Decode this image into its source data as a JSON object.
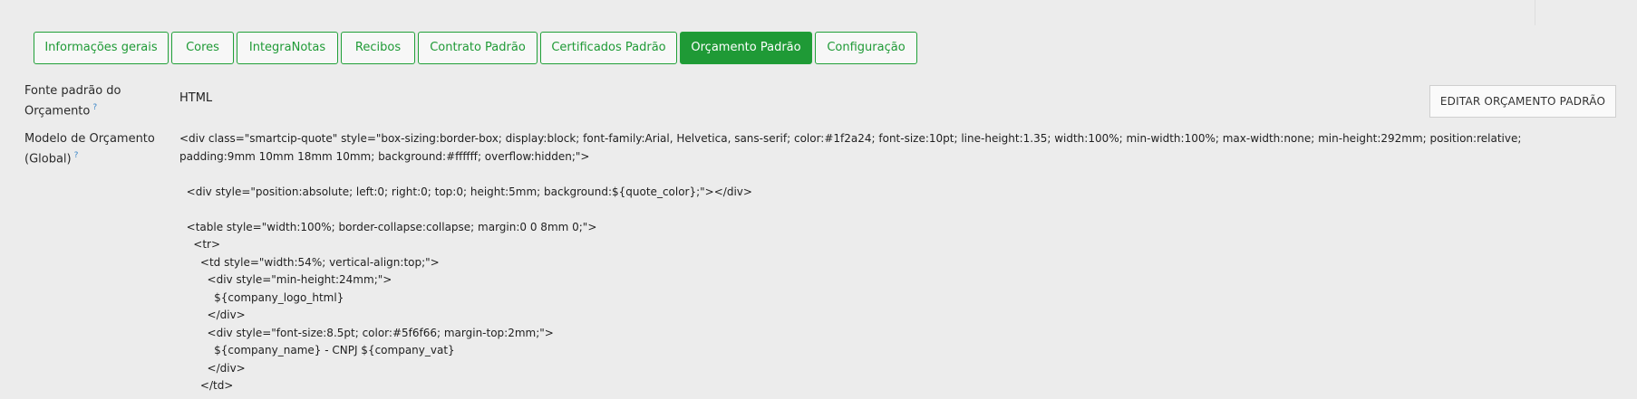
{
  "tabs": [
    {
      "label": "Informações gerais"
    },
    {
      "label": "Cores"
    },
    {
      "label": "IntegraNotas"
    },
    {
      "label": "Recibos"
    },
    {
      "label": "Contrato Padrão"
    },
    {
      "label": "Certificados Padrão"
    },
    {
      "label": "Orçamento Padrão",
      "active": true
    },
    {
      "label": "Configuração"
    }
  ],
  "fields": {
    "font": {
      "label_line1": "Fonte padrão do",
      "label_line2": "Orçamento",
      "help": "?",
      "value": "HTML"
    },
    "template": {
      "label_line1": "Modelo de Orçamento",
      "label_line2": "(Global)",
      "help": "?",
      "code": "<div class=\"smartcip-quote\" style=\"box-sizing:border-box; display:block; font-family:Arial, Helvetica, sans-serif; color:#1f2a24; font-size:10pt; line-height:1.35; width:100%; min-width:100%; max-width:none; min-height:292mm; position:relative; padding:9mm 10mm 18mm 10mm; background:#ffffff; overflow:hidden;\">\n\n  <div style=\"position:absolute; left:0; right:0; top:0; height:5mm; background:${quote_color};\"></div>\n\n  <table style=\"width:100%; border-collapse:collapse; margin:0 0 8mm 0;\">\n    <tr>\n      <td style=\"width:54%; vertical-align:top;\">\n        <div style=\"min-height:24mm;\">\n          ${company_logo_html}\n        </div>\n        <div style=\"font-size:8.5pt; color:#5f6f66; margin-top:2mm;\">\n          ${company_name} - CNPJ ${company_vat}\n        </div>\n      </td>"
    }
  },
  "edit_button": {
    "label": "EDITAR ORÇAMENTO PADRÃO"
  },
  "colors": {
    "accent": "#1f9a36",
    "background": "#ececec"
  }
}
